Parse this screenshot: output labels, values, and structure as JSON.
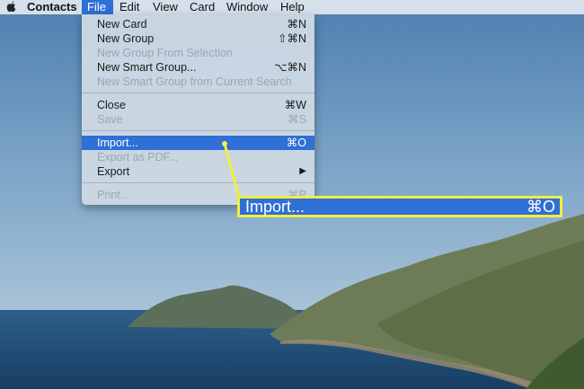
{
  "menubar": {
    "apple_icon": "apple-icon",
    "items": [
      "Contacts",
      "File",
      "Edit",
      "View",
      "Card",
      "Window",
      "Help"
    ],
    "active": "File"
  },
  "file_menu": {
    "items": [
      {
        "label": "New Card",
        "shortcut": "⌘N",
        "enabled": true
      },
      {
        "label": "New Group",
        "shortcut": "⇧⌘N",
        "enabled": true
      },
      {
        "label": "New Group From Selection",
        "shortcut": "",
        "enabled": false
      },
      {
        "label": "New Smart Group...",
        "shortcut": "⌥⌘N",
        "enabled": true
      },
      {
        "label": "New Smart Group from Current Search",
        "shortcut": "",
        "enabled": false
      },
      {
        "label": "Close",
        "shortcut": "⌘W",
        "enabled": true
      },
      {
        "label": "Save",
        "shortcut": "⌘S",
        "enabled": false
      },
      {
        "label": "Import...",
        "shortcut": "⌘O",
        "enabled": true,
        "highlighted": true
      },
      {
        "label": "Export as PDF...",
        "shortcut": "",
        "enabled": false
      },
      {
        "label": "Export",
        "shortcut": "▶",
        "enabled": true
      },
      {
        "label": "Print...",
        "shortcut": "⌘P",
        "enabled": false
      }
    ]
  },
  "callout": {
    "label": "Import...",
    "shortcut": "⌘O",
    "border_color": "#f2ef3c",
    "fill_color": "#2f6fd6"
  },
  "colors": {
    "highlight": "#2f6fd6",
    "annotation": "#f2ef3c"
  }
}
